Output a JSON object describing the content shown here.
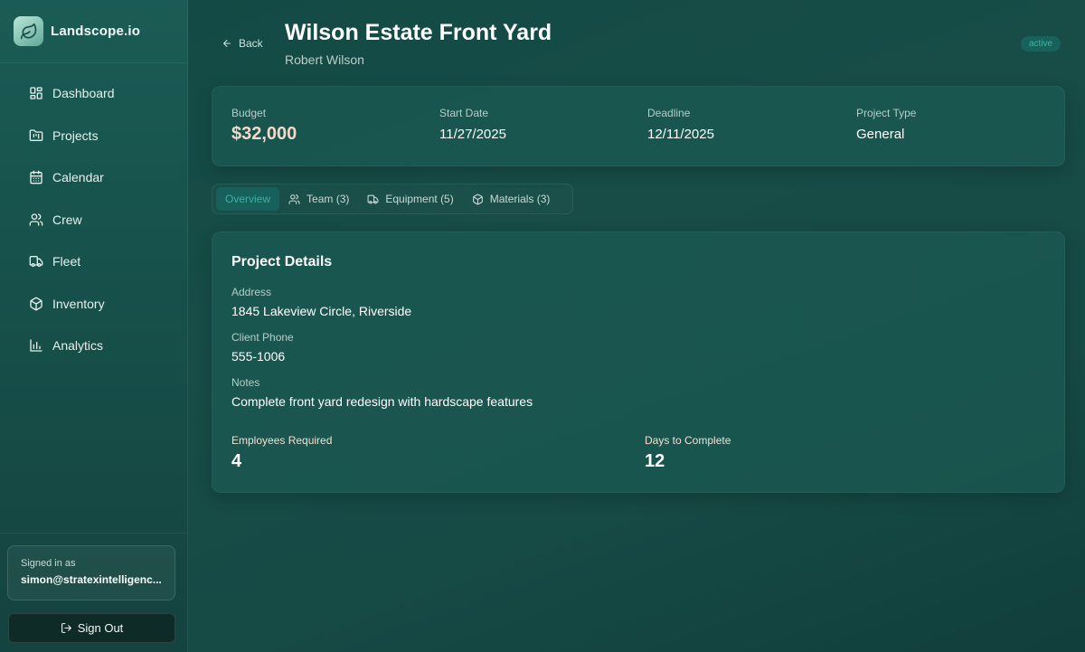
{
  "brand": {
    "name": "Landscope.io"
  },
  "nav": [
    {
      "label": "Dashboard",
      "icon": "dashboard-icon"
    },
    {
      "label": "Projects",
      "icon": "folder-icon"
    },
    {
      "label": "Calendar",
      "icon": "calendar-icon"
    },
    {
      "label": "Crew",
      "icon": "users-icon"
    },
    {
      "label": "Fleet",
      "icon": "truck-icon"
    },
    {
      "label": "Inventory",
      "icon": "box-icon"
    },
    {
      "label": "Analytics",
      "icon": "bar-chart-icon"
    }
  ],
  "user": {
    "signed_in_label": "Signed in as",
    "email": "simon@stratexintelligenc..."
  },
  "signout_label": "Sign Out",
  "header": {
    "back_label": "Back",
    "title": "Wilson Estate Front Yard",
    "client": "Robert Wilson",
    "status": "active"
  },
  "summary": {
    "budget": {
      "label": "Budget",
      "value": "$32,000"
    },
    "start_date": {
      "label": "Start Date",
      "value": "11/27/2025"
    },
    "deadline": {
      "label": "Deadline",
      "value": "12/11/2025"
    },
    "project_type": {
      "label": "Project Type",
      "value": "General"
    }
  },
  "tabs": [
    {
      "label": "Overview",
      "active": true
    },
    {
      "label": "Team (3)",
      "icon": "users-icon"
    },
    {
      "label": "Equipment (5)",
      "icon": "truck-icon"
    },
    {
      "label": "Materials (3)",
      "icon": "box-icon"
    }
  ],
  "details": {
    "title": "Project Details",
    "address": {
      "label": "Address",
      "value": "1845 Lakeview Circle, Riverside"
    },
    "phone": {
      "label": "Client Phone",
      "value": "555-1006"
    },
    "notes": {
      "label": "Notes",
      "value": "Complete front yard redesign with hardscape features"
    },
    "employees": {
      "label": "Employees Required",
      "value": "4"
    },
    "days": {
      "label": "Days to Complete",
      "value": "12"
    }
  },
  "colors": {
    "accent": "#3fb0a5",
    "budget_value": "#f4d9c8",
    "signout_bg": "#0f2b28"
  }
}
